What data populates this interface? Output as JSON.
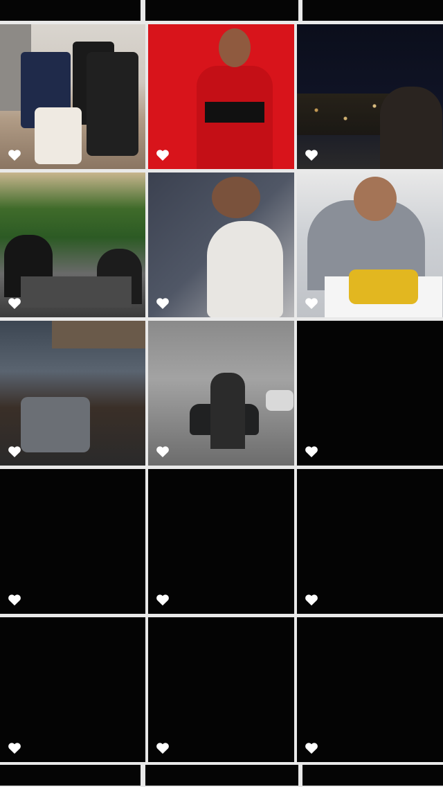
{
  "screen": {
    "background": "#e9e9e9",
    "tile_background": "#040404",
    "heart_color": "#ffffff"
  },
  "grid": {
    "tiles": [
      {
        "name": "photo-luggage",
        "kind": "photo",
        "icon": "heart-icon"
      },
      {
        "name": "photo-soccer-jersey",
        "kind": "photo",
        "icon": "heart-icon"
      },
      {
        "name": "photo-city-night",
        "kind": "photo",
        "icon": "heart-icon"
      },
      {
        "name": "photo-restaurant",
        "kind": "photo",
        "icon": "heart-icon"
      },
      {
        "name": "photo-cat",
        "kind": "photo",
        "icon": "heart-icon"
      },
      {
        "name": "photo-taco",
        "kind": "photo",
        "icon": "heart-icon"
      },
      {
        "name": "photo-balcony",
        "kind": "photo",
        "icon": "heart-icon"
      },
      {
        "name": "photo-car-showroom",
        "kind": "photo",
        "icon": "heart-icon"
      },
      {
        "name": "empty-tile",
        "kind": "black",
        "icon": "heart-icon"
      },
      {
        "name": "empty-tile",
        "kind": "black",
        "icon": "heart-icon"
      },
      {
        "name": "empty-tile",
        "kind": "black",
        "icon": "heart-icon"
      },
      {
        "name": "empty-tile",
        "kind": "black",
        "icon": "heart-icon"
      },
      {
        "name": "empty-tile",
        "kind": "black",
        "icon": "heart-icon"
      },
      {
        "name": "empty-tile",
        "kind": "black",
        "icon": "heart-icon"
      },
      {
        "name": "empty-tile",
        "kind": "black",
        "icon": "heart-icon"
      }
    ]
  }
}
